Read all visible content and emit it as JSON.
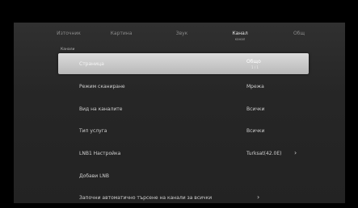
{
  "tabs": [
    {
      "label": "Източник"
    },
    {
      "label": "Картина"
    },
    {
      "label": "Звук"
    },
    {
      "label": "Канал",
      "sub": "канал",
      "active": true
    },
    {
      "label": "Общ"
    }
  ],
  "section_label": "Канали",
  "rows": [
    {
      "label": "Страница",
      "value": "Общо",
      "value_sub": "1 / 1",
      "selected": true
    },
    {
      "label": "Режим сканиране",
      "value": "Мрежа"
    },
    {
      "label": "Вид на каналите",
      "value": "Всички"
    },
    {
      "label": "Тип услуга",
      "value": "Всички"
    },
    {
      "label": "LNB1 Настройка",
      "value": "Turksat(42.0E)",
      "chevron": true
    },
    {
      "label": "Добави LNB"
    },
    {
      "label": "Започни автоматично търсене на канали за всички",
      "chevron": true
    }
  ]
}
